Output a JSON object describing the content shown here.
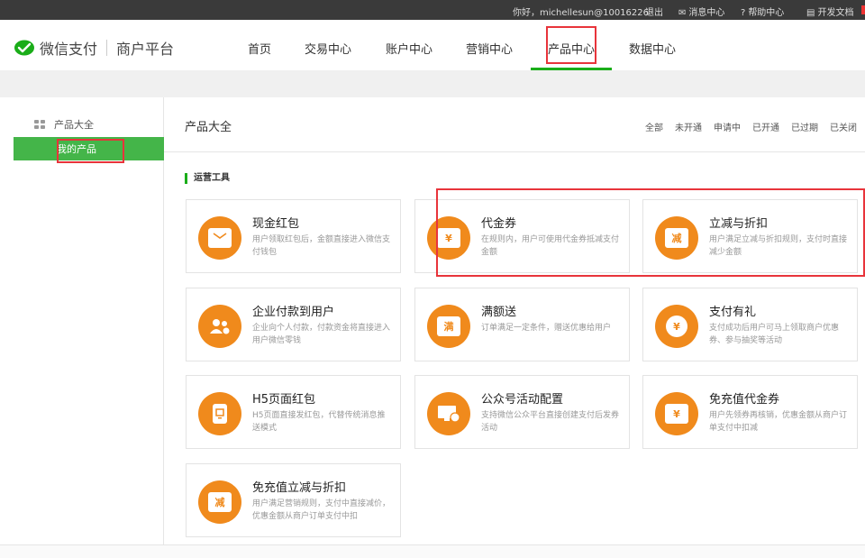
{
  "topbar": {
    "greeting": "你好，michellesun@10016226",
    "logout": "退出",
    "messages": "消息中心",
    "help": "帮助中心",
    "docs": "开发文档"
  },
  "header": {
    "logo_text": "微信支付",
    "platform": "商户平台",
    "nav": [
      "首页",
      "交易中心",
      "账户中心",
      "营销中心",
      "产品中心",
      "数据中心"
    ],
    "active_nav": "产品中心"
  },
  "sidebar": {
    "heading": "产品大全",
    "active_item": "我的产品"
  },
  "main": {
    "title": "产品大全",
    "filters": [
      "全部",
      "未开通",
      "申请中",
      "已开通",
      "已过期",
      "已关闭"
    ],
    "section": "运营工具",
    "cards": [
      {
        "title": "现金红包",
        "desc": "用户领取红包后，金额直接进入微信支付钱包",
        "icon": "red-envelope-icon",
        "glyph": ""
      },
      {
        "title": "代金券",
        "desc": "在规则内，用户可使用代金券抵减支付金额",
        "icon": "voucher-icon",
        "glyph": "¥"
      },
      {
        "title": "立减与折扣",
        "desc": "用户满足立减与折扣规则，支付时直接减少金额",
        "icon": "discount-icon",
        "glyph": "减"
      },
      {
        "title": "企业付款到用户",
        "desc": "企业向个人付款，付款资金将直接进入用户微信零钱",
        "icon": "users-pay-icon",
        "glyph": ""
      },
      {
        "title": "满额送",
        "desc": "订单满足一定条件，赠送优惠给用户",
        "icon": "full-gift-icon",
        "glyph": "满"
      },
      {
        "title": "支付有礼",
        "desc": "支付成功后用户可马上领取商户优惠券、参与抽奖等活动",
        "icon": "pay-gift-icon",
        "glyph": "¥"
      },
      {
        "title": "H5页面红包",
        "desc": "H5页面直接发红包，代替传统消息推送模式",
        "icon": "h5-envelope-icon",
        "glyph": ""
      },
      {
        "title": "公众号活动配置",
        "desc": "支持微信公众平台直接创建支付后发券活动",
        "icon": "official-account-icon",
        "glyph": ""
      },
      {
        "title": "免充值代金券",
        "desc": "用户先领券再核销，优惠金额从商户订单支付中扣减",
        "icon": "free-voucher-icon",
        "glyph": "¥"
      },
      {
        "title": "免充值立减与折扣",
        "desc": "用户满足营销规则，支付中直接减价，优惠金额从商户订单支付中扣",
        "icon": "free-discount-icon",
        "glyph": "减"
      }
    ]
  },
  "colors": {
    "accent": "#1aad19",
    "orange": "#f08a1c",
    "annotation": "#e8343b"
  }
}
